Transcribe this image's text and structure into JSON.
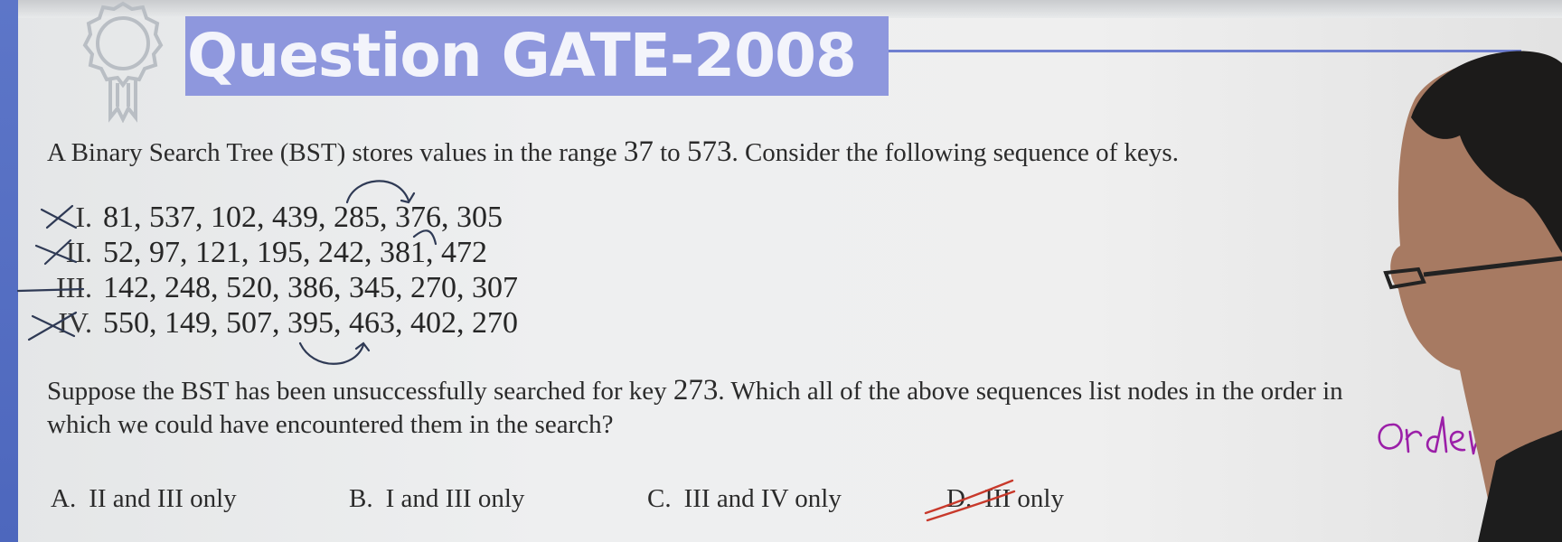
{
  "slide": {
    "title": "Question GATE-2008",
    "question": {
      "pre": "A Binary Search Tree (BST) stores values in the range ",
      "low": "37",
      "mid": " to ",
      "high": "573",
      "post": ". Consider the following sequence of keys."
    },
    "sequences": [
      {
        "roman": "I.",
        "values": "81, 537, 102, 439, 285, 376, 305"
      },
      {
        "roman": "II.",
        "values": "52, 97, 121, 195, 242, 381, 472"
      },
      {
        "roman": "III.",
        "values": "142, 248, 520, 386, 345, 270, 307"
      },
      {
        "roman": "IV.",
        "values": "550, 149, 507, 395, 463, 402, 270"
      }
    ],
    "prompt": {
      "line1_pre": "Suppose the BST has been unsuccessfully searched for key ",
      "key": "273",
      "line1_post": ". Which all of the above sequences list nodes in the order in",
      "line2": "which we could have encountered them in the search?"
    },
    "options": [
      {
        "letter": "A.",
        "text": "II and III only"
      },
      {
        "letter": "B.",
        "text": "I and III only"
      },
      {
        "letter": "C.",
        "text": "III and IV only"
      },
      {
        "letter": "D.",
        "text": "III only"
      }
    ],
    "handwritten_note": "order",
    "colors": {
      "accent": "#8e97dd",
      "left_bar": "#5d76c8",
      "ink_dark": "#2f3a55",
      "ink_red": "#c8392b",
      "ink_purple": "#9b1fa8"
    }
  }
}
